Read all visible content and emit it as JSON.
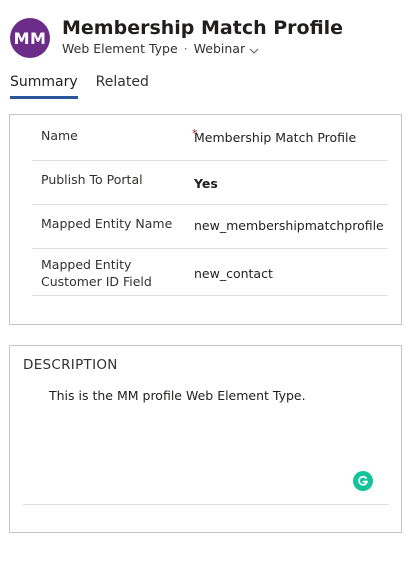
{
  "record": {
    "avatar_initials": "MM",
    "title": "Membership Match Profile",
    "entity_type": "Web Element Type",
    "separator": "·",
    "form_name": "Webinar"
  },
  "tabs": [
    {
      "label": "Summary",
      "active": true
    },
    {
      "label": "Related",
      "active": false
    }
  ],
  "fields": [
    {
      "label": "Name",
      "required_marker": "*",
      "value": "Membership Match Profile"
    },
    {
      "label": "Publish To Portal",
      "value": "Yes"
    },
    {
      "label": "Mapped Entity Name",
      "value": "new_membershipmatchprofile"
    },
    {
      "label_line1": "Mapped Entity",
      "label_line2": "Customer ID Field",
      "value": "new_contact"
    }
  ],
  "description": {
    "title": "DESCRIPTION",
    "text": "This is the MM profile Web Element Type."
  },
  "colors": {
    "avatar": "#6b2c8a",
    "tab_underline": "#2b579a",
    "highlight": "#f5ef1a",
    "grammarly": "#15c39a",
    "required": "#a4262c"
  },
  "icons": {
    "form_dropdown": "chevron-down-icon",
    "grammarly": "grammarly-icon"
  }
}
